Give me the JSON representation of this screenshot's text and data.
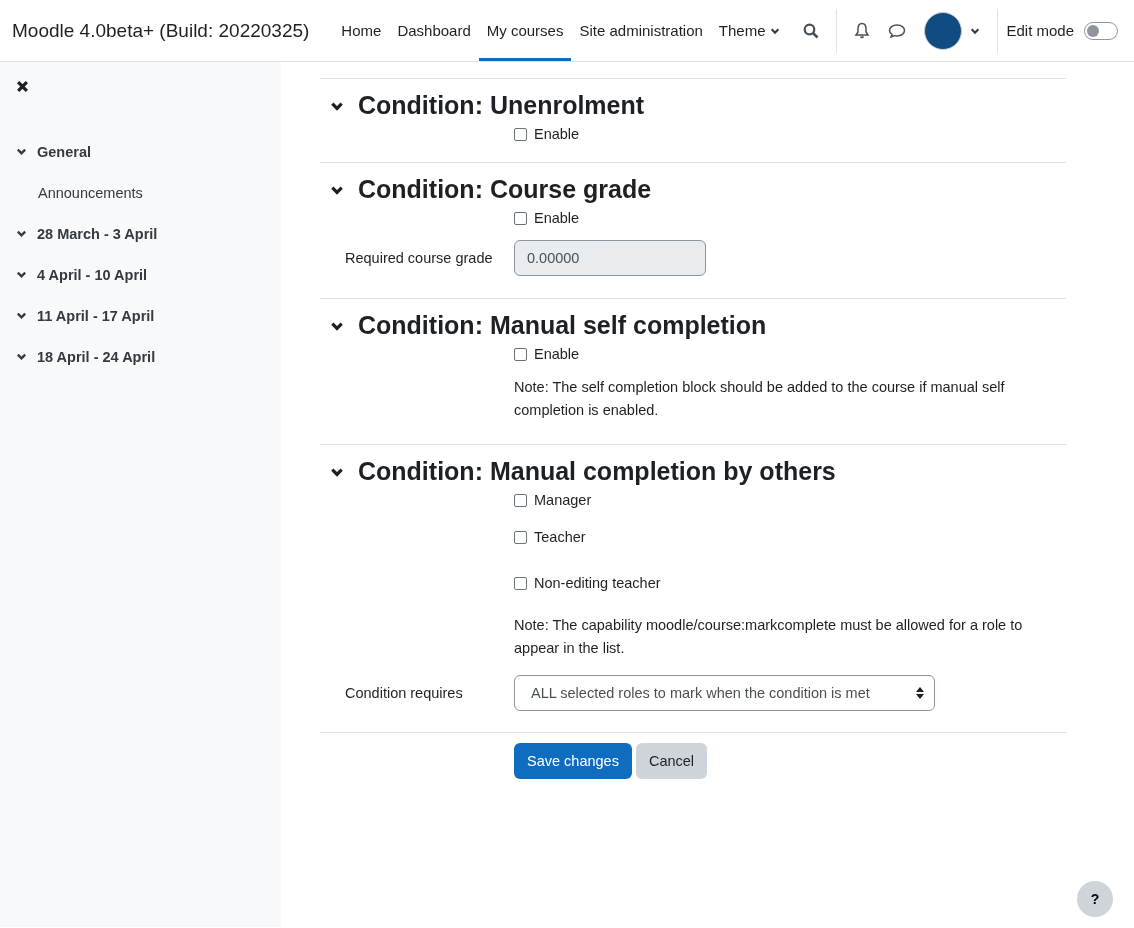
{
  "navbar": {
    "site_name": "Moodle 4.0beta+ (Build: 20220325)",
    "links": [
      {
        "label": "Home",
        "selected": false,
        "dropdown": false
      },
      {
        "label": "Dashboard",
        "selected": false,
        "dropdown": false
      },
      {
        "label": "My courses",
        "selected": true,
        "dropdown": false
      },
      {
        "label": "Site administration",
        "selected": false,
        "dropdown": false
      },
      {
        "label": "Theme",
        "selected": false,
        "dropdown": true
      }
    ],
    "edit_mode": {
      "label": "Edit mode",
      "on": false
    }
  },
  "sidebar": {
    "items": [
      {
        "label": "General",
        "expanded": true,
        "children": [
          {
            "label": "Announcements"
          }
        ]
      },
      {
        "label": "28 March - 3 April",
        "expanded": true
      },
      {
        "label": "4 April - 10 April",
        "expanded": true
      },
      {
        "label": "11 April - 17 April",
        "expanded": true
      },
      {
        "label": "18 April - 24 April",
        "expanded": true
      }
    ]
  },
  "sections": [
    {
      "title": "Condition: Unenrolment",
      "expanded": true,
      "fields": [
        {
          "kind": "checkbox",
          "label": "Enable",
          "checked": false
        }
      ]
    },
    {
      "title": "Condition: Course grade",
      "expanded": true,
      "fields": [
        {
          "kind": "checkbox",
          "label": "Enable",
          "checked": false
        },
        {
          "kind": "text",
          "label": "Required course grade",
          "value": "0.00000",
          "disabled": true
        }
      ]
    },
    {
      "title": "Condition: Manual self completion",
      "expanded": true,
      "fields": [
        {
          "kind": "checkbox",
          "label": "Enable",
          "checked": false
        },
        {
          "kind": "note",
          "text": "Note: The self completion block should be added to the course if manual self completion is enabled."
        }
      ]
    },
    {
      "title": "Condition: Manual completion by others",
      "expanded": true,
      "fields": [
        {
          "kind": "checkbox",
          "label": "Manager",
          "checked": false
        },
        {
          "kind": "checkbox",
          "label": "Teacher",
          "checked": false
        },
        {
          "kind": "checkbox",
          "label": "Non-editing teacher",
          "checked": false
        },
        {
          "kind": "note",
          "text": "Note: The capability moodle/course:markcomplete must be allowed for a role to appear in the list."
        },
        {
          "kind": "select",
          "label": "Condition requires",
          "value": "ALL selected roles to mark when the condition is met"
        }
      ]
    }
  ],
  "buttons": [
    {
      "label": "Save changes",
      "kind": "primary"
    },
    {
      "label": "Cancel",
      "kind": "secondary"
    }
  ],
  "help_button": "?"
}
